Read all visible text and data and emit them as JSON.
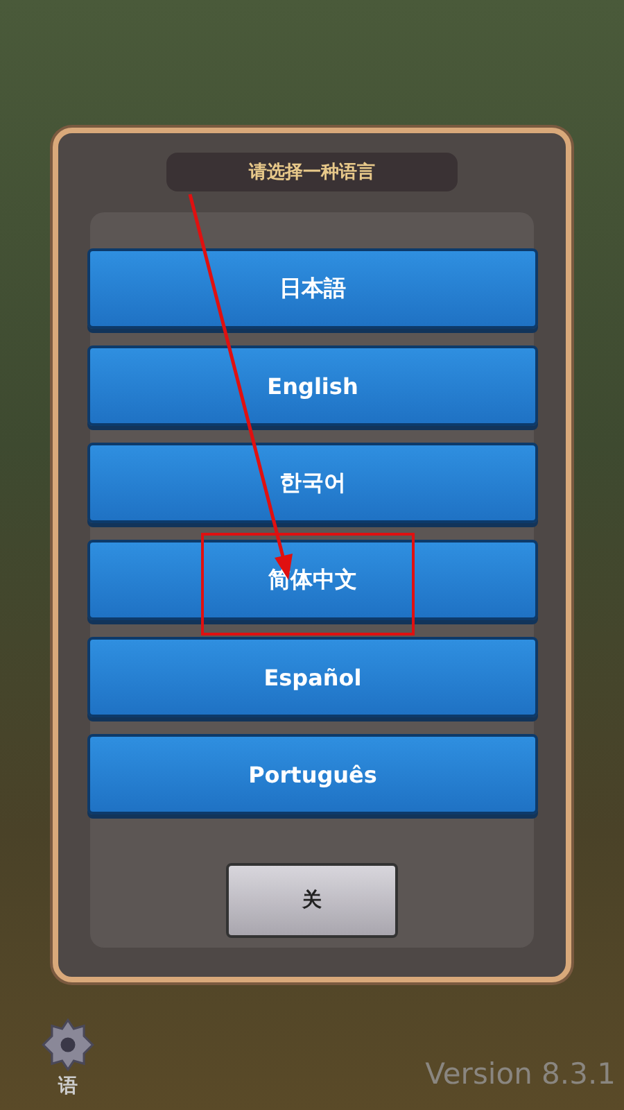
{
  "dialog": {
    "title": "请选择一种语言",
    "languages": [
      {
        "label": "日本語",
        "highlighted": false
      },
      {
        "label": "English",
        "highlighted": false
      },
      {
        "label": "한국어",
        "highlighted": false
      },
      {
        "label": "简体中文",
        "highlighted": true
      },
      {
        "label": "Español",
        "highlighted": false
      },
      {
        "label": "Português",
        "highlighted": false
      }
    ],
    "close_button": "关"
  },
  "settings": {
    "label": "语"
  },
  "version": "Version 8.3.1"
}
